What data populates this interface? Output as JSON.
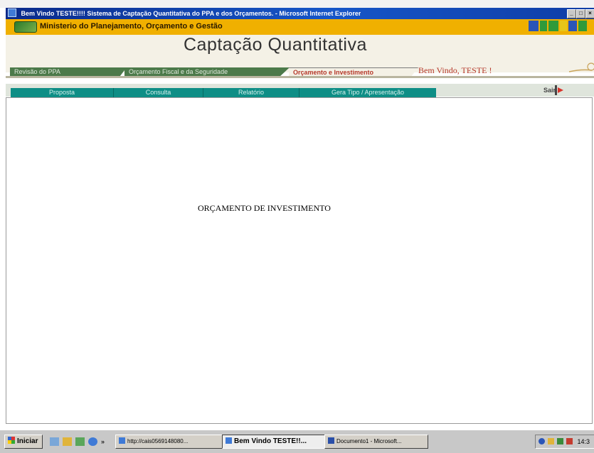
{
  "window": {
    "title": "Bem Vindo TESTE!!!! Sistema de Captação Quantitativa do PPA e dos Orçamentos. - Microsoft Internet Explorer",
    "controls": [
      "_",
      "□",
      "×"
    ]
  },
  "ministry": {
    "name": "Ministerio do Planejamento, Orçamento e Gestão",
    "brand_logo_text": "BRASIL"
  },
  "header": {
    "title": "Captação Quantitativa",
    "welcome": "Bem Vindo, TESTE !"
  },
  "module_tabs": [
    {
      "label": "Revisão do PPA",
      "active": false
    },
    {
      "label": "Orçamento Fiscal e da Seguridade",
      "active": false
    },
    {
      "label": "Orçamento e Investimento",
      "active": true
    }
  ],
  "sub_nav": [
    {
      "label": "Proposta"
    },
    {
      "label": "Consulta"
    },
    {
      "label": "Relatório"
    },
    {
      "label": "Gera Tipo / Apresentação"
    }
  ],
  "sair": {
    "label": "Sair"
  },
  "content": {
    "heading": "ORÇAMENTO DE INVESTIMENTO"
  },
  "taskbar": {
    "start_label": "Iniciar",
    "tasks": [
      {
        "label": "http://cais0569148080...",
        "active": false
      },
      {
        "label": "Bem Vindo TESTE!!...",
        "active": true
      },
      {
        "label": "Documento1 - Microsoft...",
        "active": false
      }
    ],
    "clock": "14:3"
  },
  "colors": {
    "accent_teal": "#0e8e86",
    "ministry_bar": "#f0b000",
    "welcome_red": "#b5382a",
    "module_tab_green": "#4c7a4a"
  }
}
